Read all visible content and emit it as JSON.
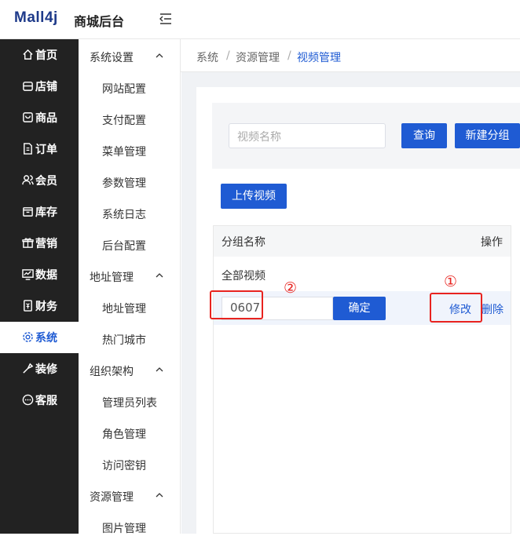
{
  "header": {
    "logo": "Mall4j",
    "title": "商城后台"
  },
  "nav1": [
    {
      "label": "首页",
      "icon": "home-icon"
    },
    {
      "label": "店铺",
      "icon": "shop-icon"
    },
    {
      "label": "商品",
      "icon": "product-icon"
    },
    {
      "label": "订单",
      "icon": "order-icon"
    },
    {
      "label": "会员",
      "icon": "member-icon"
    },
    {
      "label": "库存",
      "icon": "inventory-icon"
    },
    {
      "label": "营销",
      "icon": "gift-icon"
    },
    {
      "label": "数据",
      "icon": "data-icon"
    },
    {
      "label": "财务",
      "icon": "finance-icon"
    },
    {
      "label": "系统",
      "icon": "gear-icon"
    },
    {
      "label": "装修",
      "icon": "decor-icon"
    },
    {
      "label": "客服",
      "icon": "chat-icon"
    }
  ],
  "nav2": {
    "groups": [
      {
        "label": "系统设置",
        "items": [
          "网站配置",
          "支付配置",
          "菜单管理",
          "参数管理",
          "系统日志",
          "后台配置"
        ]
      },
      {
        "label": "地址管理",
        "items": [
          "地址管理",
          "热门城市"
        ]
      },
      {
        "label": "组织架构",
        "items": [
          "管理员列表",
          "角色管理",
          "访问密钥"
        ]
      },
      {
        "label": "资源管理",
        "items": [
          "图片管理"
        ]
      }
    ]
  },
  "breadcrumb": [
    "系统",
    "资源管理",
    "视频管理"
  ],
  "search": {
    "placeholder": "视频名称",
    "query_label": "查询",
    "new_group_label": "新建分组"
  },
  "upload_label": "上传视频",
  "table": {
    "col_name": "分组名称",
    "col_action": "操作",
    "all_videos": "全部视频",
    "edit_row": {
      "value": "0607",
      "confirm_label": "确定",
      "edit_label": "修改",
      "delete_label": "删除"
    }
  },
  "annotations": {
    "step1": "①",
    "step2": "②",
    "color": "#e8231f"
  },
  "colors": {
    "accent": "#1f5bd3",
    "sidebar": "#222222"
  }
}
